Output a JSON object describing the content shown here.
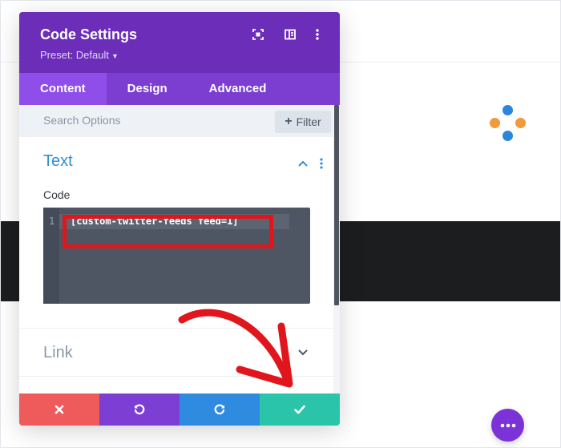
{
  "modal": {
    "title": "Code Settings",
    "preset_label": "Preset: Default",
    "tabs": [
      {
        "label": "Content",
        "active": true
      },
      {
        "label": "Design",
        "active": false
      },
      {
        "label": "Advanced",
        "active": false
      }
    ],
    "search": {
      "placeholder": "Search Options"
    },
    "filter_label": "Filter",
    "sections": {
      "text_title": "Text",
      "code_label": "Code",
      "code_line_number": "1",
      "code_value": "[custom-twitter-feeds feed=1]",
      "link_title": "Link"
    },
    "footer_icons": [
      "close-icon",
      "undo-icon",
      "redo-icon",
      "check-icon"
    ]
  },
  "colors": {
    "header": "#6c2eb9",
    "tabs": "#7c3ed0",
    "active_tab": "#8f4eea",
    "section_accent": "#2d8fd5",
    "discard": "#ef5a5a",
    "undo": "#7d3fd3",
    "redo": "#2f8be0",
    "save": "#29c4a9",
    "annotation": "#e0161c"
  }
}
